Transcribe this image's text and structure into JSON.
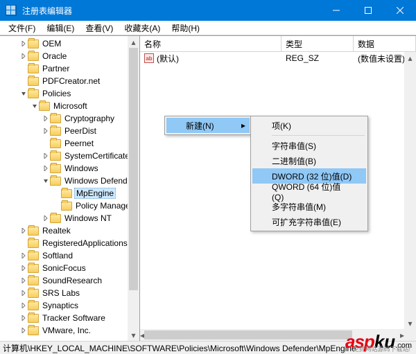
{
  "titlebar": {
    "title": "注册表编辑器"
  },
  "menu": {
    "file": "文件(F)",
    "edit": "编辑(E)",
    "view": "查看(V)",
    "favorites": "收藏夹(A)",
    "help": "帮助(H)"
  },
  "tree": {
    "items": [
      {
        "label": "OEM",
        "indent": 1,
        "exp": "closed"
      },
      {
        "label": "Oracle",
        "indent": 1,
        "exp": "closed"
      },
      {
        "label": "Partner",
        "indent": 1,
        "exp": "none"
      },
      {
        "label": "PDFCreator.net",
        "indent": 1,
        "exp": "none"
      },
      {
        "label": "Policies",
        "indent": 1,
        "exp": "open"
      },
      {
        "label": "Microsoft",
        "indent": 2,
        "exp": "open"
      },
      {
        "label": "Cryptography",
        "indent": 3,
        "exp": "closed"
      },
      {
        "label": "PeerDist",
        "indent": 3,
        "exp": "closed"
      },
      {
        "label": "Peernet",
        "indent": 3,
        "exp": "none"
      },
      {
        "label": "SystemCertificates",
        "indent": 3,
        "exp": "closed"
      },
      {
        "label": "Windows",
        "indent": 3,
        "exp": "closed"
      },
      {
        "label": "Windows Defender",
        "indent": 3,
        "exp": "open"
      },
      {
        "label": "MpEngine",
        "indent": 4,
        "exp": "none",
        "selected": true
      },
      {
        "label": "Policy Manager",
        "indent": 4,
        "exp": "none"
      },
      {
        "label": "Windows NT",
        "indent": 3,
        "exp": "closed"
      },
      {
        "label": "Realtek",
        "indent": 1,
        "exp": "closed"
      },
      {
        "label": "RegisteredApplications",
        "indent": 1,
        "exp": "none"
      },
      {
        "label": "Softland",
        "indent": 1,
        "exp": "closed"
      },
      {
        "label": "SonicFocus",
        "indent": 1,
        "exp": "closed"
      },
      {
        "label": "SoundResearch",
        "indent": 1,
        "exp": "closed"
      },
      {
        "label": "SRS Labs",
        "indent": 1,
        "exp": "closed"
      },
      {
        "label": "Synaptics",
        "indent": 1,
        "exp": "closed"
      },
      {
        "label": "Tracker Software",
        "indent": 1,
        "exp": "closed"
      },
      {
        "label": "VMware, Inc.",
        "indent": 1,
        "exp": "closed"
      }
    ]
  },
  "list": {
    "columns": {
      "name": "名称",
      "type": "类型",
      "data": "数据"
    },
    "rows": [
      {
        "name": "(默认)",
        "type": "REG_SZ",
        "data": "(数值未设置)"
      }
    ]
  },
  "context1": {
    "new": "新建(N)"
  },
  "context2": {
    "key": "项(K)",
    "string": "字符串值(S)",
    "binary": "二进制值(B)",
    "dword": "DWORD (32 位)值(D)",
    "qword": "QWORD (64 位)值(Q)",
    "multistring": "多字符串值(M)",
    "expandstring": "可扩充字符串值(E)"
  },
  "statusbar": "计算机\\HKEY_LOCAL_MACHINE\\SOFTWARE\\Policies\\Microsoft\\Windows Defender\\MpEngine",
  "watermark": {
    "asp": "asp",
    "ku": "ku",
    "com": ".com",
    "sub": "免费网站源码下载站!"
  }
}
